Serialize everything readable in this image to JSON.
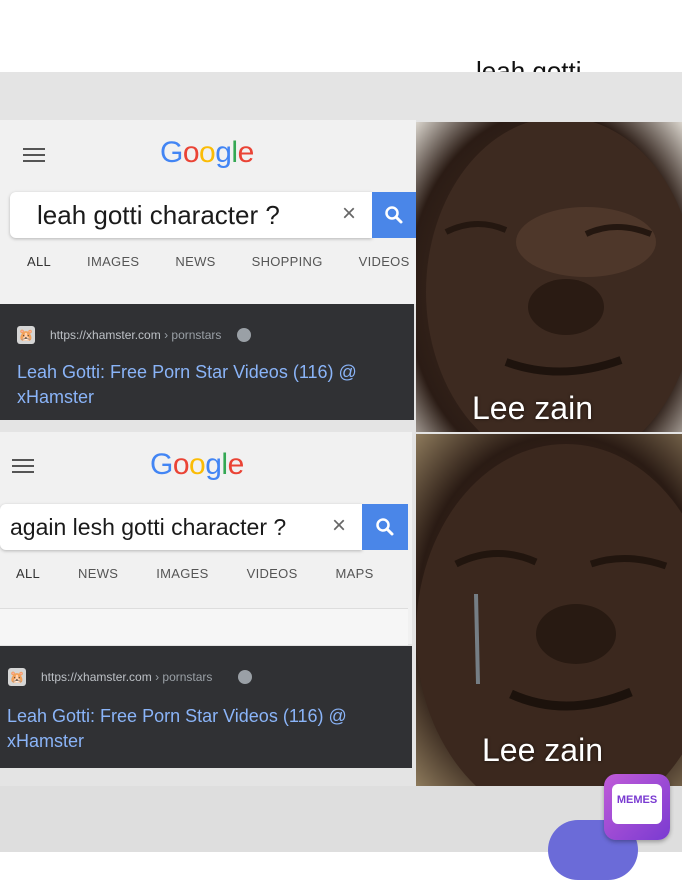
{
  "top_fragment_text": "leah gotti",
  "google_logo_letters": [
    "G",
    "o",
    "o",
    "g",
    "l",
    "e"
  ],
  "panel1": {
    "query": "leah gotti character ?",
    "clear_glyph": "×",
    "tabs": [
      "ALL",
      "IMAGES",
      "NEWS",
      "SHOPPING",
      "VIDEOS"
    ],
    "result": {
      "url": "https://xhamster.com",
      "breadcrumb": "› pornstars",
      "title": "Leah Gotti: Free Porn Star Videos (116) @ xHamster"
    }
  },
  "panel2": {
    "query": "again  lesh gotti character ?",
    "clear_glyph": "×",
    "tabs": [
      "ALL",
      "NEWS",
      "IMAGES",
      "VIDEOS",
      "MAPS"
    ],
    "result": {
      "url": "https://xhamster.com",
      "breadcrumb": "› pornstars",
      "title": "Leah Gotti: Free Porn Star Videos (116) @ xHamster"
    }
  },
  "captions": {
    "top": "Lee zain",
    "bottom": "Lee zain"
  },
  "watermark": {
    "label": "MEMES"
  },
  "colors": {
    "google_blue": "#4285f4",
    "search_button": "#4a86e8",
    "result_bg": "#303134",
    "link": "#8ab4f8"
  }
}
